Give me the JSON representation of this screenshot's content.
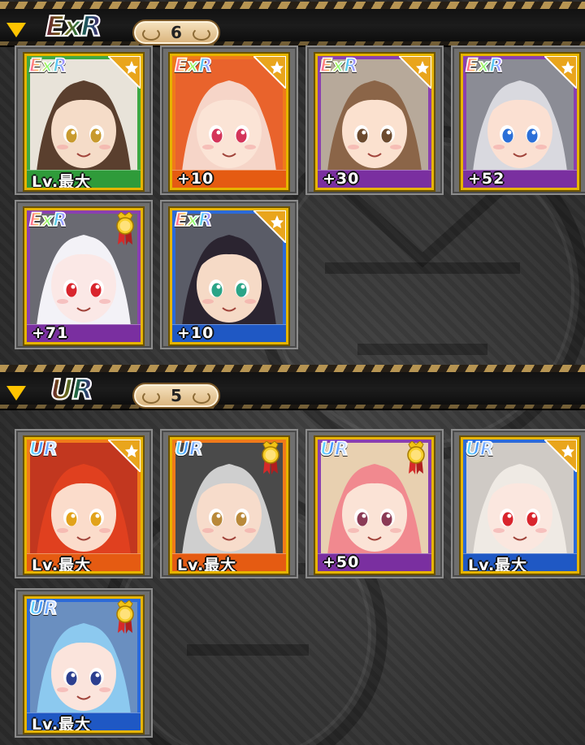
{
  "sections": [
    {
      "rarity": "ExR",
      "count": "6",
      "cards": [
        {
          "rarity": "ExR",
          "level": "Lv.最大",
          "frame": "#3ea843",
          "bar": "#2f9b3a",
          "hair": "#5a3f2e",
          "eyes": "#c89a2e",
          "skin": "#f5dcc8",
          "bg": "#e8e3d9",
          "corner": "star"
        },
        {
          "rarity": "ExR",
          "level": "+10",
          "frame": "#f07a1a",
          "bar": "#e55b12",
          "hair": "#f6d5c8",
          "eyes": "#d4345a",
          "skin": "#fbe4d6",
          "bg": "#e9632c",
          "corner": "star"
        },
        {
          "rarity": "ExR",
          "level": "+30",
          "frame": "#8a3fb0",
          "bar": "#7a2fa0",
          "hair": "#8b6548",
          "eyes": "#6b4a2e",
          "skin": "#fbe1cf",
          "bg": "#b7a99a",
          "corner": "star"
        },
        {
          "rarity": "ExR",
          "level": "+52",
          "frame": "#8a3fb0",
          "bar": "#7a2fa0",
          "hair": "#d9d9df",
          "eyes": "#2a6fd8",
          "skin": "#fbe0d2",
          "bg": "#8b8c95",
          "corner": "star"
        },
        {
          "rarity": "ExR",
          "level": "+71",
          "frame": "#8a3fb0",
          "bar": "#7a2fa0",
          "hair": "#f3f2f7",
          "eyes": "#d9252d",
          "skin": "#fbe8e6",
          "bg": "#6a6a72",
          "corner": "medal"
        },
        {
          "rarity": "ExR",
          "level": "+10",
          "frame": "#2b6ad9",
          "bar": "#1f58c4",
          "hair": "#2b2430",
          "eyes": "#2aa487",
          "skin": "#f6dac6",
          "bg": "#5a5c67",
          "corner": "star"
        }
      ]
    },
    {
      "rarity": "UR",
      "count": "5",
      "cards": [
        {
          "rarity": "UR",
          "level": "Lv.最大",
          "frame": "#f07a1a",
          "bar": "#e55b12",
          "hair": "#e0401f",
          "eyes": "#e2a21a",
          "skin": "#fbdccb",
          "bg": "#c2371f",
          "corner": "star"
        },
        {
          "rarity": "UR",
          "level": "Lv.最大",
          "frame": "#f07a1a",
          "bar": "#e55b12",
          "hair": "#cfcfcf",
          "eyes": "#b9893a",
          "skin": "#f7dccb",
          "bg": "#4a4a4a",
          "corner": "medal"
        },
        {
          "rarity": "UR",
          "level": "+50",
          "frame": "#8a3fb0",
          "bar": "#7a2fa0",
          "hair": "#f1898f",
          "eyes": "#8a3a55",
          "skin": "#fbe3d6",
          "bg": "#e8d0b0",
          "corner": "medal"
        },
        {
          "rarity": "UR",
          "level": "Lv.最大",
          "frame": "#2b6ad9",
          "bar": "#1f58c4",
          "hair": "#efeae4",
          "eyes": "#d9252d",
          "skin": "#fbe7df",
          "bg": "#cfcac5",
          "corner": "star"
        },
        {
          "rarity": "UR",
          "level": "Lv.最大",
          "frame": "#2b6ad9",
          "bar": "#1f58c4",
          "hair": "#8cc9ef",
          "eyes": "#2c3f8f",
          "skin": "#fbe4dc",
          "bg": "#6a8fc0",
          "corner": "medal"
        }
      ]
    }
  ]
}
